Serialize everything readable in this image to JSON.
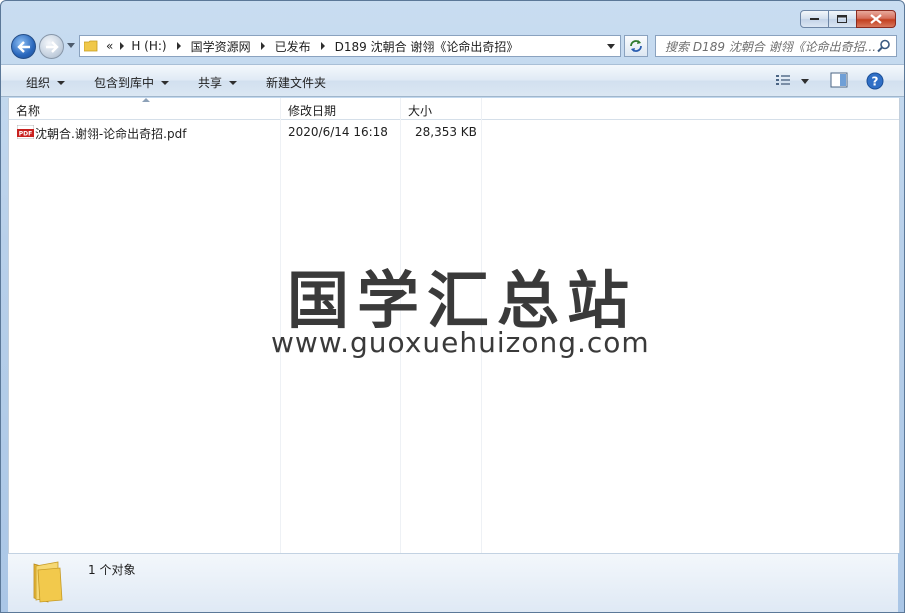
{
  "window": {
    "caption_buttons": [
      "minimize",
      "maximize",
      "close"
    ]
  },
  "address_bar": {
    "overflow": "«",
    "crumbs": [
      "H (H:)",
      "国学资源网",
      "已发布",
      "D189 沈朝合 谢翎《论命出奇招》"
    ]
  },
  "search": {
    "placeholder": "搜索 D189 沈朝合 谢翎《论命出奇招..."
  },
  "toolbar": {
    "organize": "组织",
    "include_library": "包含到库中",
    "share": "共享",
    "new_folder": "新建文件夹"
  },
  "columns": {
    "name": "名称",
    "modified": "修改日期",
    "size": "大小"
  },
  "files": [
    {
      "name": "沈朝合.谢翎-论命出奇招.pdf",
      "modified": "2020/6/14 16:18",
      "size": "28,353 KB",
      "icon": "pdf-file-icon"
    }
  ],
  "watermark": {
    "chinese": "国学汇总站",
    "url": "www.guoxuehuizong.com"
  },
  "details": {
    "count": "1 个对象"
  },
  "colors": {
    "frame": "#b8d0ea",
    "accent": "#2a68bd",
    "close": "#c3401f"
  }
}
